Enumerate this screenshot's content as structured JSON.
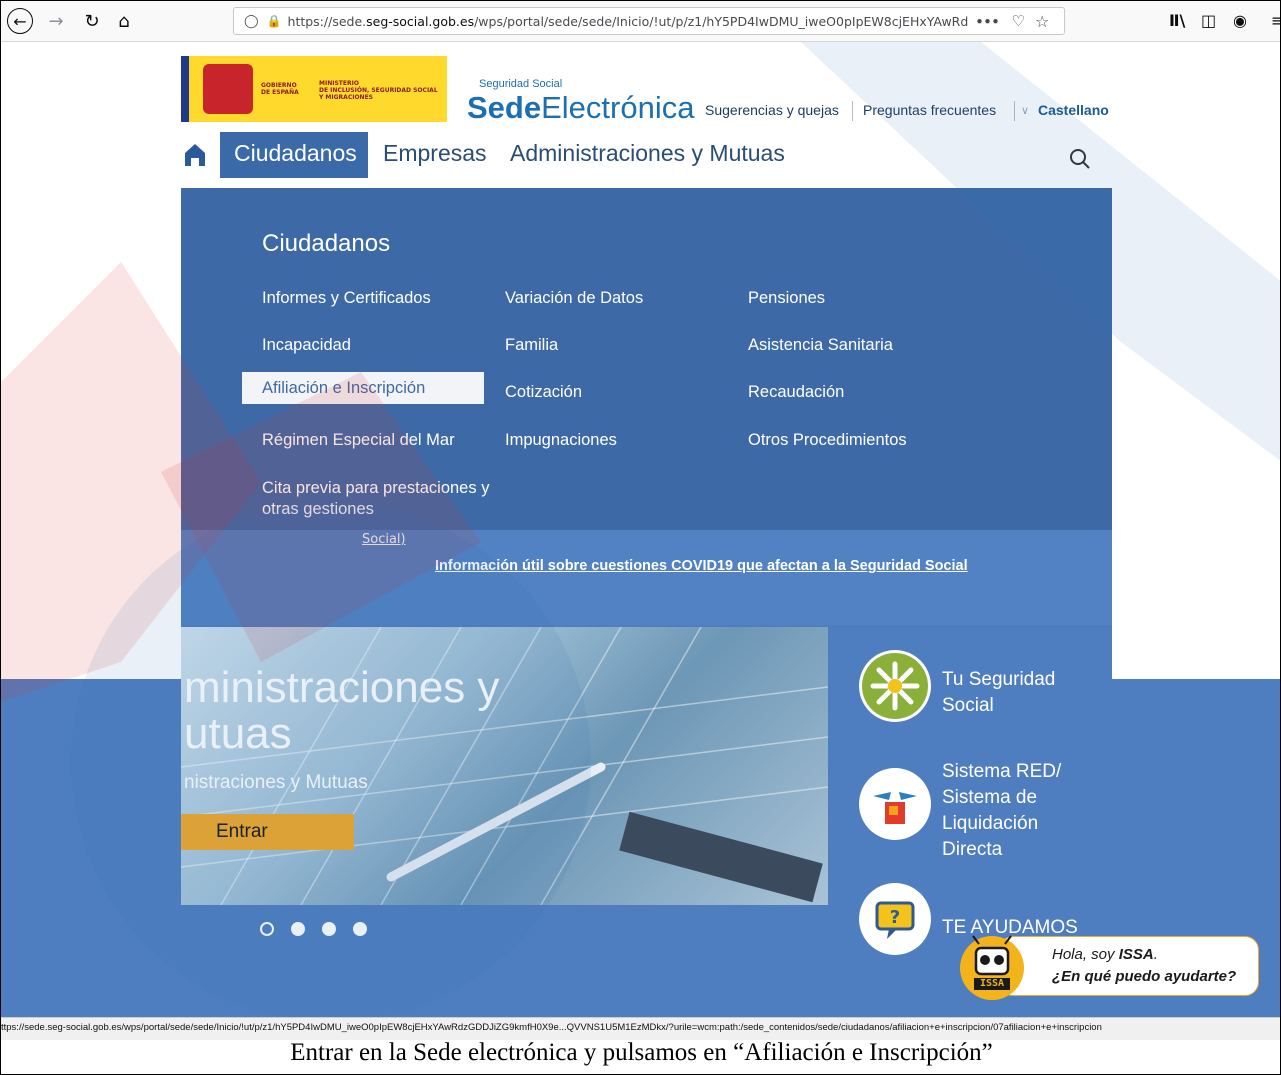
{
  "browser": {
    "url_prefix": "https://sede.",
    "url_domain": "seg-social.gob.es",
    "url_rest": "/wps/portal/sede/sede/Inicio/!ut/p/z1/hY5PD4IwDMU_iweO0pIpEW8cjEHxYAwRdzGDDJ",
    "more_icon": "•••"
  },
  "header": {
    "gov_line1": "GOBIERNO",
    "gov_line2": "DE ESPAÑA",
    "ministry_line1": "MINISTERIO",
    "ministry_line2": "DE INCLUSIÓN, SEGURIDAD SOCIAL",
    "ministry_line3": "Y MIGRACIONES",
    "brand_small": "Seguridad Social",
    "brand_bold": "Sede",
    "brand_light": "Electrónica",
    "link_suggestions": "Sugerencias y quejas",
    "link_faq": "Preguntas frecuentes",
    "language": "Castellano"
  },
  "nav": {
    "items": [
      "Ciudadanos",
      "Empresas",
      "Administraciones y Mutuas"
    ]
  },
  "menu": {
    "title": "Ciudadanos",
    "col1": [
      "Informes y Certificados",
      "Incapacidad",
      "Afiliación e Inscripción",
      "Régimen Especial del Mar",
      "Cita previa para prestaciones y otras gestiones"
    ],
    "col2": [
      "Variación de Datos",
      "Familia",
      "Cotización",
      "Impugnaciones"
    ],
    "col3": [
      "Pensiones",
      "Asistencia Sanitaria",
      "Recaudación",
      "Otros Procedimientos"
    ]
  },
  "band": {
    "social_fragment": "Social)",
    "covid_link": "Información útil sobre cuestiones COVID19 que afectan a la Seguridad Social"
  },
  "hero": {
    "line1": "ministraciones y",
    "line2": "utuas",
    "line3": "nistraciones y Mutuas",
    "button": "Entrar",
    "slides_total": 4,
    "active_slide": 1
  },
  "sidebar": {
    "item1": [
      "Tu Seguridad",
      "Social"
    ],
    "item2": [
      "Sistema RED/",
      "Sistema de",
      "Liquidación",
      "Directa"
    ],
    "item3": "TE AYUDAMOS"
  },
  "issa": {
    "greeting_prefix": "Hola, soy ",
    "greeting_name": "ISSA",
    "greeting_suffix": ".",
    "question": "¿En qué puedo ayudarte?",
    "robot_label": "ISSA"
  },
  "status_url": "ttps://sede.seg-social.gob.es/wps/portal/sede/sede/Inicio/!ut/p/z1/hY5PD4IwDMU_iweO0pIpEW8cjEHxYAwRdzGDDJiZG9kmfH0X9e...QVVNS1U5M1EzMDkx/?urile=wcm:path:/sede_contenidos/sede/ciudadanos/afiliacion+e+inscripcion/07afiliacion+e+inscripcion",
  "caption": "Entrar en la Sede electrónica y pulsamos en “Afiliación e Inscripción”",
  "colors": {
    "menu_bg": "#3d6aa7",
    "band_bg": "#5282c3",
    "accent_orange": "#f0a92b",
    "brand_blue": "#1b6fb2"
  }
}
